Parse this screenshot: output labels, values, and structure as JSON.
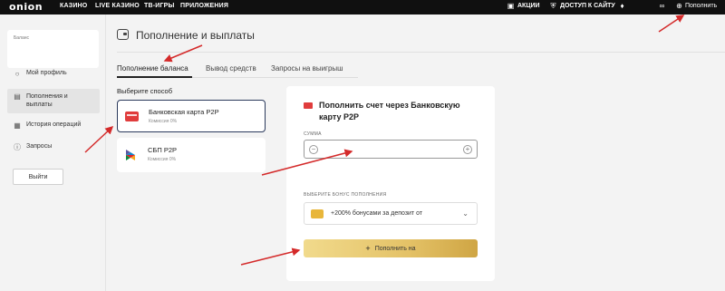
{
  "topbar": {
    "logo": "onion",
    "nav": [
      "КАЗИНО",
      "LIVE КАЗИНО",
      "ТВ-ИГРЫ",
      "ПРИЛОЖЕНИЯ"
    ],
    "promotions": "АКЦИИ",
    "site_access": "ДОСТУП К САЙТУ",
    "deposit": "Пополнить"
  },
  "sidebar": {
    "balance_label": "Баланс",
    "items": [
      {
        "label": "Мой профиль",
        "icon": "user-icon"
      },
      {
        "label": "Пополнения и выплаты",
        "icon": "wallet-icon",
        "active": true
      },
      {
        "label": "История операций",
        "icon": "grid-icon"
      },
      {
        "label": "Запросы",
        "icon": "question-icon"
      }
    ],
    "logout": "Выйти"
  },
  "main": {
    "title": "Пополнение и выплаты",
    "tabs": [
      "Пополнение баланса",
      "Вывод средств",
      "Запросы на выигрыш"
    ],
    "active_tab": 0,
    "choose_method": "Выберите способ",
    "methods": [
      {
        "title": "Банковская карта P2P",
        "subtitle": "Комиссия 0%"
      },
      {
        "title": "СБП P2P",
        "subtitle": "Комиссия 0%"
      }
    ]
  },
  "panel": {
    "title": "Пополнить счет через Банковскую карту P2P",
    "amount_label": "СУММА",
    "amount_value": "",
    "bonus_label": "ВЫБЕРИТЕ БОНУС ПОПОЛНЕНИЯ",
    "bonus_value": "+200% бонусами за депозит от",
    "deposit_button": "Пополнить на"
  },
  "colors": {
    "topbar_bg": "#101010",
    "accent_gold": "#e4c267",
    "card_red": "#e03c3c",
    "selected_border": "#2b3a5c",
    "annotation_arrow": "#d42a2a"
  }
}
